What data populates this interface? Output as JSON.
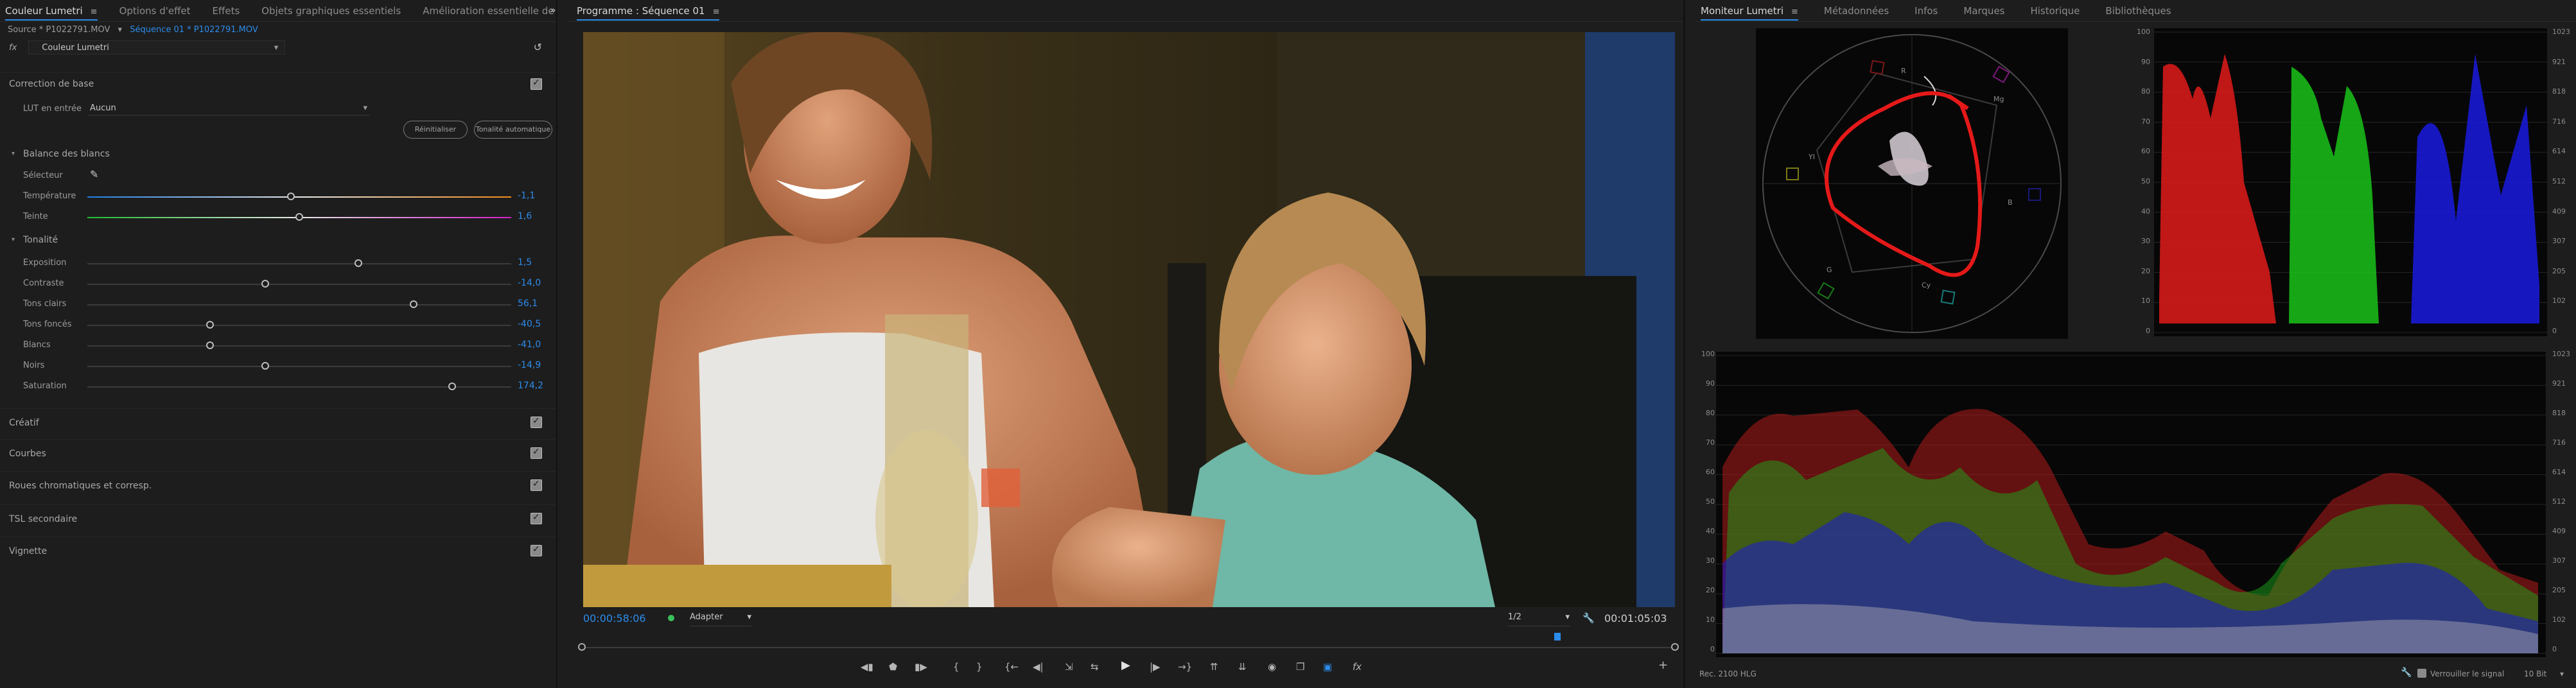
{
  "left_panel": {
    "tabs": [
      {
        "label": "Couleur Lumetri",
        "active": true
      },
      {
        "label": "Options d'effet"
      },
      {
        "label": "Effets"
      },
      {
        "label": "Objets graphiques essentiels"
      },
      {
        "label": "Amélioration essentielle de l'au"
      }
    ],
    "source_text": "Source * P1022791.MOV",
    "sequence_text": "Séquence 01 * P1022791.MOV",
    "fx_label": "fx",
    "effect_name": "Couleur Lumetri",
    "basic_section": "Correction de base",
    "lut_label": "LUT en entrée",
    "lut_value": "Aucun",
    "reset_button": "Réinitialiser",
    "auto_button": "Tonalité automatique",
    "wb_section": "Balance des blancs",
    "selector_label": "Sélecteur",
    "tone_section": "Tonalité",
    "sliders": [
      {
        "label": "Température",
        "value": "-1,1",
        "pos": 0.48,
        "track": "temp"
      },
      {
        "label": "Teinte",
        "value": "1,6",
        "pos": 0.5,
        "track": "tint"
      },
      {
        "label": "Exposition",
        "value": "1,5",
        "pos": 0.64,
        "track": "gray"
      },
      {
        "label": "Contraste",
        "value": "-14,0",
        "pos": 0.42,
        "track": "gray"
      },
      {
        "label": "Tons clairs",
        "value": "56,1",
        "pos": 0.77,
        "track": "gray"
      },
      {
        "label": "Tons foncés",
        "value": "-40,5",
        "pos": 0.29,
        "track": "gray"
      },
      {
        "label": "Blancs",
        "value": "-41,0",
        "pos": 0.29,
        "track": "gray"
      },
      {
        "label": "Noirs",
        "value": "-14,9",
        "pos": 0.42,
        "track": "gray"
      },
      {
        "label": "Saturation",
        "value": "174,2",
        "pos": 0.86,
        "track": "gray"
      }
    ],
    "sections": [
      "Créatif",
      "Courbes",
      "Roues chromatiques et corresp.",
      "TSL secondaire",
      "Vignette"
    ]
  },
  "program": {
    "title": "Programme : Séquence 01",
    "timecode_current": "00:00:58:06",
    "fit_label": "Adapter",
    "resolution": "1/2",
    "timecode_total": "00:01:05:03",
    "transport_icons": [
      "marker-in-icon",
      "marker-icon",
      "marker-out-icon",
      "brace-open-icon",
      "brace-close-icon",
      "go-to-in-icon",
      "step-back-icon",
      "insert-icon",
      "play-icon",
      "step-forward-icon",
      "go-to-out-icon",
      "lift-icon",
      "extract-icon",
      "export-frame-icon",
      "compare-icon",
      "vr-icon",
      "fx-icon"
    ]
  },
  "scopes": {
    "tabs": [
      {
        "label": "Moniteur Lumetri",
        "active": true
      },
      {
        "label": "Métadonnées"
      },
      {
        "label": "Infos"
      },
      {
        "label": "Marques"
      },
      {
        "label": "Historique"
      },
      {
        "label": "Bibliothèques"
      }
    ],
    "vector_labels": [
      "R",
      "Mg",
      "B",
      "Cy",
      "G",
      "YI"
    ],
    "parade_left_ticks": [
      "100",
      "90",
      "80",
      "70",
      "60",
      "50",
      "40",
      "30",
      "20",
      "10",
      "0"
    ],
    "parade_right_ticks": [
      "1023",
      "921",
      "818",
      "716",
      "614",
      "512",
      "409",
      "307",
      "205",
      "102",
      "0"
    ],
    "footer_left": "Rec. 2100 HLG",
    "clamp_label": "Verrouiller le signal",
    "bit_depth": "10 Bit"
  }
}
